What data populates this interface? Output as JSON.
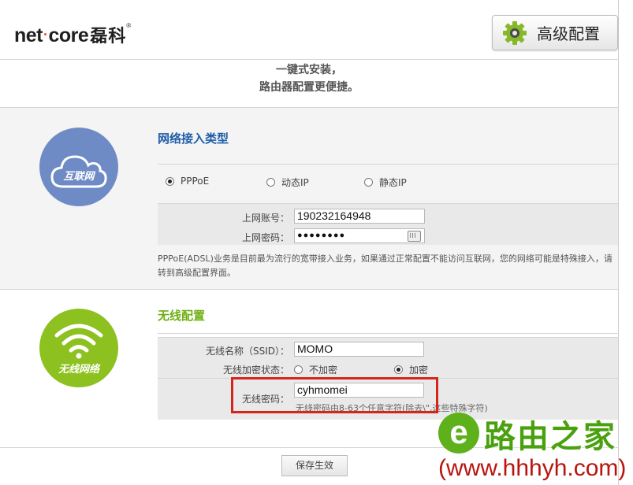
{
  "header": {
    "logo_text": "net",
    "logo_dot": "·",
    "logo_text2": "core",
    "logo_cn": "磊科",
    "logo_reg": "®",
    "advanced_button_label": "高级配置"
  },
  "slogan": {
    "line1": "一键式安装，",
    "line2": "路由器配置更便捷。"
  },
  "internet": {
    "icon_caption": "互联网",
    "title": "网络接入类型",
    "types": [
      {
        "label": "PPPoE",
        "selected": true
      },
      {
        "label": "动态IP",
        "selected": false
      },
      {
        "label": "静态IP",
        "selected": false
      }
    ],
    "account_label": "上网账号：",
    "account_value": "190232164948",
    "password_label": "上网密码：",
    "password_value": "●●●●●●●●",
    "note": "PPPoE(ADSL)业务是目前最为流行的宽带接入业务，如果通过正常配置不能访问互联网，您的网络可能是特殊接入，请转到高级配置界面。"
  },
  "wireless": {
    "icon_caption": "无线网络",
    "title": "无线配置",
    "ssid_label": "无线名称（SSID）：",
    "ssid_value": "MOMO",
    "encrypt_label": "无线加密状态：",
    "encrypt_options": [
      {
        "label": "不加密",
        "selected": false
      },
      {
        "label": "加密",
        "selected": true
      }
    ],
    "password_label": "无线密码：",
    "password_value": "cyhmomei",
    "password_hint": "无线密码由8-63个任意字符(除去\\\",这些特殊字符)"
  },
  "save_button_label": "保存生效",
  "watermark": {
    "logo_letter": "e",
    "cn": "路由之家",
    "url": "(www.hhhyh.com)"
  },
  "colors": {
    "internet_circle": "#6f8bc6",
    "wifi_circle": "#8cc11f",
    "title_blue": "#1f5da8",
    "title_green": "#6fae13",
    "highlight_red": "#d4261b"
  }
}
